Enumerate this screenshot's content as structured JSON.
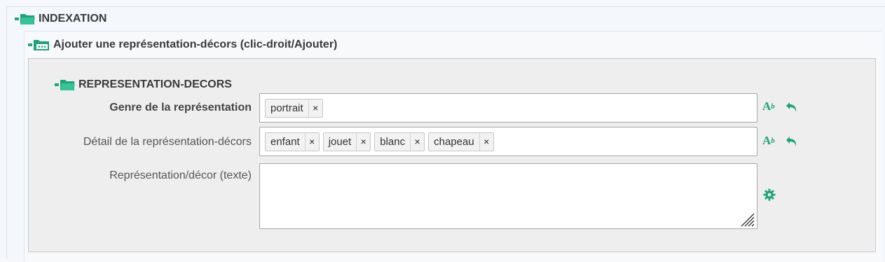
{
  "sections": {
    "indexation": {
      "title": "INDEXATION",
      "icon": "folder-open-icon"
    },
    "add_representation": {
      "title": "Ajouter une représentation-décors (clic-droit/Ajouter)",
      "icon": "folder-menu-icon"
    },
    "representation_decors": {
      "title": "REPRESENTATION-DECORS",
      "icon": "folder-open-icon"
    }
  },
  "fields": {
    "genre": {
      "label": "Genre de la représentation",
      "tags": [
        "portrait"
      ],
      "remove_symbol": "×"
    },
    "detail": {
      "label": "Détail de la représentation-décors",
      "tags": [
        "enfant",
        "jouet",
        "blanc",
        "chapeau"
      ],
      "remove_symbol": "×"
    },
    "texte": {
      "label": "Représentation/décor (texte)",
      "value": ""
    }
  },
  "icons": {
    "ab_main": "A",
    "ab_sup": "b"
  },
  "colors": {
    "accent": "#1fa37c",
    "panel_bg": "#eeeeee",
    "border": "#a6a6a6"
  }
}
